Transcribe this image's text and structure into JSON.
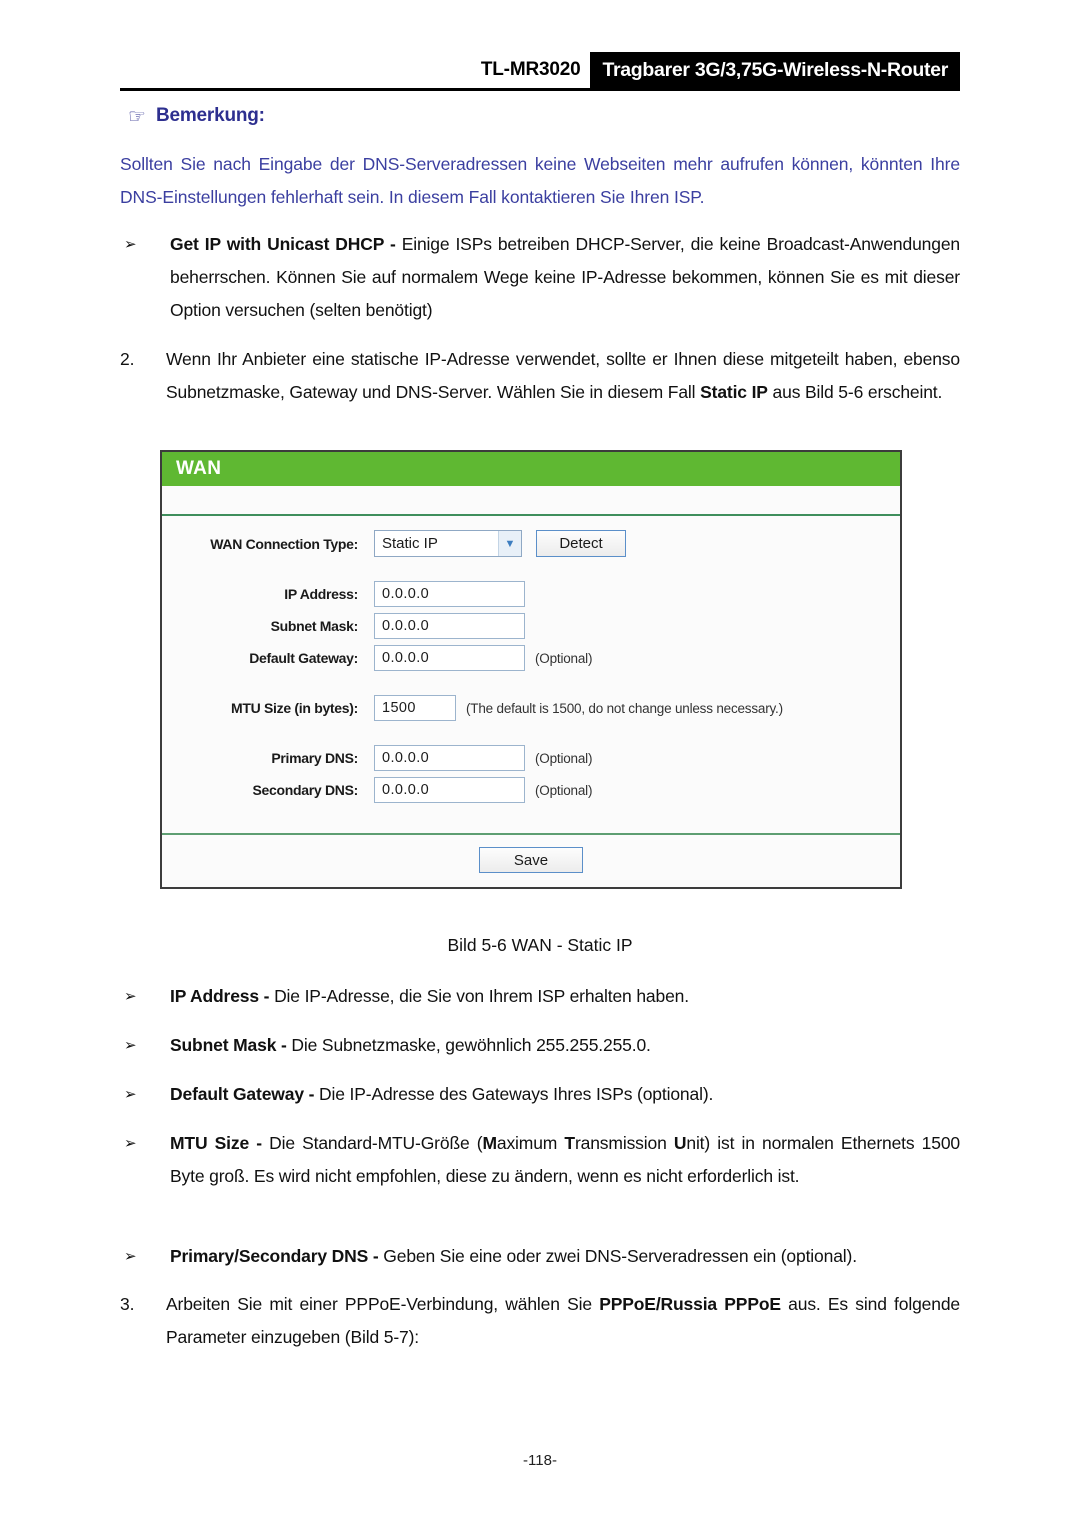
{
  "header": {
    "model": "TL-MR3020",
    "product": "Tragbarer 3G/3,75G-Wireless-N-Router"
  },
  "note": {
    "icon": "pointing-hand-icon",
    "title": "Bemerkung:",
    "body": "Sollten Sie nach Eingabe der DNS-Serveradressen keine Webseiten mehr aufrufen können, könnten Ihre DNS-Einstellungen fehlerhaft sein. In diesem Fall kontaktieren Sie Ihren ISP."
  },
  "bullet_dhcp": {
    "marker": "➢",
    "term": "Get IP with Unicast DHCP -",
    "text": " Einige ISPs betreiben DHCP-Server, die keine Broadcast-Anwendungen beherrschen. Können Sie auf normalem Wege keine IP-Adresse bekommen, können Sie es mit dieser Option versuchen (selten benötigt)"
  },
  "step2": {
    "marker": "2.",
    "text_a": "Wenn Ihr Anbieter eine statische IP-Adresse verwendet, sollte er Ihnen diese mitgeteilt haben, ebenso Subnetzmaske, Gateway und DNS-Server. Wählen Sie in diesem Fall ",
    "bold_a": "Static IP",
    "text_b": " aus Bild 5-6 erscheint."
  },
  "router_ui": {
    "title": "WAN",
    "connection_type_label": "WAN Connection Type:",
    "connection_type_value": "Static IP",
    "detect_button": "Detect",
    "fields": [
      {
        "label": "IP Address:",
        "value": "0.0.0.0",
        "hint": ""
      },
      {
        "label": "Subnet Mask:",
        "value": "0.0.0.0",
        "hint": ""
      },
      {
        "label": "Default Gateway:",
        "value": "0.0.0.0",
        "hint": "(Optional)"
      }
    ],
    "mtu": {
      "label": "MTU Size (in bytes):",
      "value": "1500",
      "hint": "(The default is 1500, do not change unless necessary.)"
    },
    "dns": [
      {
        "label": "Primary DNS:",
        "value": "0.0.0.0",
        "hint": "(Optional)"
      },
      {
        "label": "Secondary DNS:",
        "value": "0.0.0.0",
        "hint": "(Optional)"
      }
    ],
    "save_button": "Save",
    "colors": {
      "title_bar_green": "#5fb832",
      "separator_green": "#3f8e5c",
      "input_border_blue": "#9cb4cd",
      "button_border_blue": "#5b8fc9"
    }
  },
  "figure_caption": "Bild 5-6 WAN - Static IP",
  "bullets": {
    "ip_address": {
      "marker": "➢",
      "term": "IP Address -",
      "text": " Die IP-Adresse, die Sie von Ihrem ISP erhalten haben."
    },
    "subnet_mask": {
      "marker": "➢",
      "term": "Subnet Mask -",
      "text": " Die Subnetzmaske, gewöhnlich 255.255.255.0."
    },
    "default_gw": {
      "marker": "➢",
      "term": "Default Gateway -",
      "text": " Die IP-Adresse des Gateways Ihres ISPs (optional)."
    },
    "mtu_size": {
      "marker": "➢",
      "term": "MTU Size -",
      "text_a": " Die Standard-MTU-Größe (",
      "b_m": "M",
      "t_m": "aximum ",
      "b_t": "T",
      "t_t": "ransmission ",
      "b_u": "U",
      "t_u": "nit",
      "text_b": ") ist in normalen Ethernets 1500 Byte groß. Es wird nicht empfohlen, diese zu ändern, wenn es nicht erforderlich ist."
    },
    "dns": {
      "marker": "➢",
      "term": "Primary/Secondary DNS -",
      "text": " Geben Sie eine oder zwei DNS-Serveradressen ein (optional)."
    }
  },
  "step3": {
    "marker": "3.",
    "text_a": "Arbeiten Sie mit einer PPPoE-Verbindung, wählen Sie ",
    "bold_a": "PPPoE/Russia PPPoE",
    "text_b": " aus. Es sind folgende Parameter einzugeben (Bild 5-7):"
  },
  "page_number": "-118-"
}
